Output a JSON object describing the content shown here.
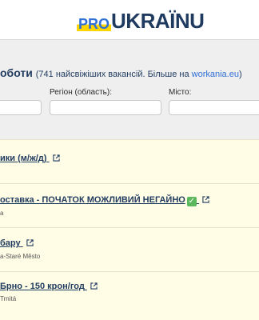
{
  "header": {
    "logo_pro": "PRO",
    "logo_ukraine": "UKRAÏNU"
  },
  "filters": {
    "title": "оботи",
    "count_text": "(741 найсвіжіших вакансій. Більше на ",
    "link_text": "workania.eu",
    "count_suffix": ")",
    "region_label": "Регіон (область):",
    "city_label": "Місто:"
  },
  "jobs": [
    {
      "title": "ики (м/ж/д)",
      "meta": ""
    },
    {
      "title": "оставка - ПОЧАТОК МОЖЛИВИЙ НЕГАЙНО",
      "meta": "а"
    },
    {
      "title": "бару",
      "meta": "а-Staré Město"
    },
    {
      "title": "Брно - 150 крон/год",
      "meta": "Trnitá"
    }
  ],
  "colors": {
    "brand_blue": "#2f6fd6",
    "brand_yellow": "#ffd500",
    "list_background": "#fffde6",
    "check_green": "#5cb85c"
  }
}
